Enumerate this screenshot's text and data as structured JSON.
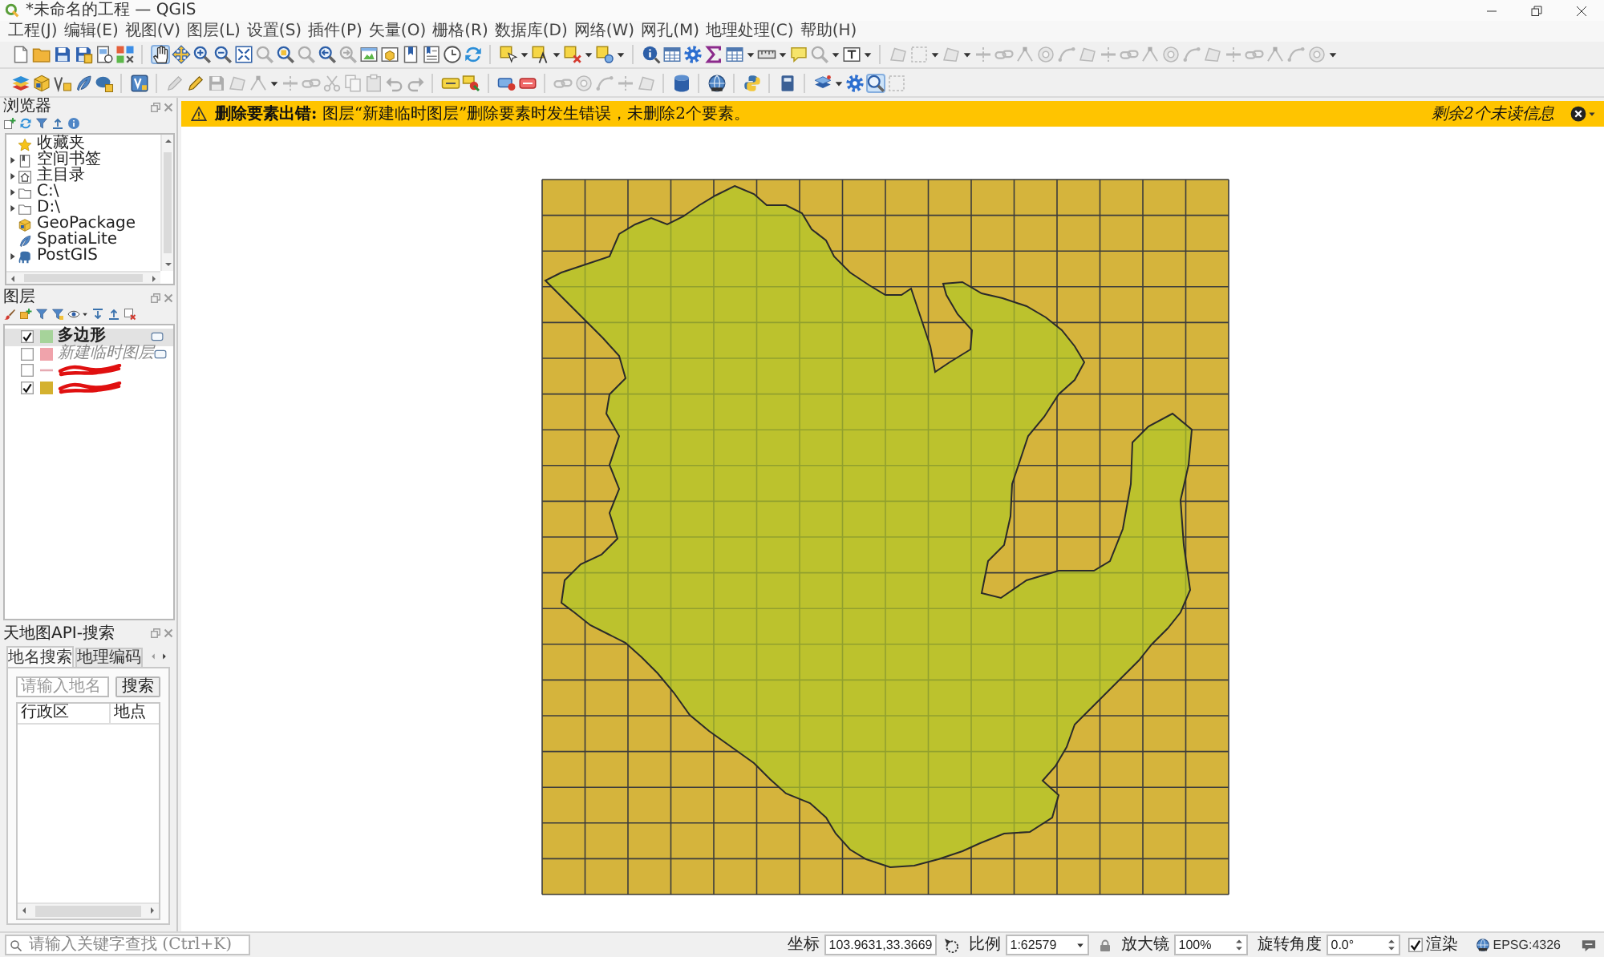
{
  "window": {
    "title": "*未命名的工程 — QGIS"
  },
  "menu_bar": [
    "工程(J)",
    "编辑(E)",
    "视图(V)",
    "图层(L)",
    "设置(S)",
    "插件(P)",
    "矢量(O)",
    "栅格(R)",
    "数据库(D)",
    "网络(W)",
    "网孔(M)",
    "地理处理(C)",
    "帮助(H)"
  ],
  "toolbars": [
    [
      {
        "kind": "new",
        "disabled": false,
        "selected": false
      },
      {
        "kind": "open",
        "disabled": false,
        "selected": false
      },
      {
        "kind": "save",
        "disabled": false,
        "selected": false
      },
      {
        "kind": "saveas",
        "disabled": false,
        "selected": false
      },
      {
        "kind": "layout",
        "disabled": false,
        "selected": false
      },
      {
        "kind": "style",
        "disabled": false,
        "selected": false
      },
      {
        "kind": "sep"
      },
      {
        "kind": "pan",
        "disabled": false,
        "selected": true
      },
      {
        "kind": "move",
        "disabled": false,
        "selected": false
      },
      {
        "kind": "zin",
        "disabled": false,
        "selected": false
      },
      {
        "kind": "zout",
        "disabled": false,
        "selected": false
      },
      {
        "kind": "zfull",
        "disabled": false,
        "selected": false
      },
      {
        "kind": "mag",
        "disabled": true,
        "selected": false
      },
      {
        "kind": "zlayer",
        "disabled": false,
        "selected": false
      },
      {
        "kind": "mag",
        "disabled": true,
        "selected": false
      },
      {
        "kind": "zlast",
        "disabled": false,
        "selected": false
      },
      {
        "kind": "znext",
        "disabled": true,
        "selected": false
      },
      {
        "kind": "view",
        "disabled": false,
        "selected": false
      },
      {
        "kind": "view3d",
        "disabled": false,
        "selected": false
      },
      {
        "kind": "bmark",
        "disabled": false,
        "selected": false
      },
      {
        "kind": "bmlist",
        "disabled": false,
        "selected": false
      },
      {
        "kind": "clock",
        "disabled": false,
        "selected": false
      },
      {
        "kind": "refresh",
        "disabled": false,
        "selected": false
      },
      {
        "kind": "sep"
      },
      {
        "kind": "select",
        "disabled": false,
        "selected": false
      },
      {
        "kind": "caret"
      },
      {
        "kind": "selexpr",
        "disabled": false,
        "selected": false
      },
      {
        "kind": "caret"
      },
      {
        "kind": "desel",
        "disabled": false,
        "selected": false
      },
      {
        "kind": "caret"
      },
      {
        "kind": "selloc",
        "disabled": false,
        "selected": false
      },
      {
        "kind": "caret"
      },
      {
        "kind": "sep"
      },
      {
        "kind": "info",
        "disabled": false,
        "selected": false
      },
      {
        "kind": "attr",
        "disabled": false,
        "selected": false
      },
      {
        "kind": "gear",
        "disabled": false,
        "selected": false
      },
      {
        "kind": "sigma",
        "disabled": false,
        "selected": false
      },
      {
        "kind": "attr",
        "disabled": false,
        "selected": false
      },
      {
        "kind": "caret"
      },
      {
        "kind": "ruler",
        "disabled": false,
        "selected": false
      },
      {
        "kind": "caret"
      },
      {
        "kind": "tip",
        "disabled": false,
        "selected": false
      },
      {
        "kind": "mag",
        "disabled": true,
        "selected": false
      },
      {
        "kind": "caret"
      },
      {
        "kind": "text",
        "disabled": false,
        "selected": false
      },
      {
        "kind": "caret"
      },
      {
        "kind": "sep"
      },
      {
        "kind": "poly",
        "disabled": true,
        "selected": false
      },
      {
        "kind": "frame",
        "disabled": true,
        "selected": false
      },
      {
        "kind": "caret"
      },
      {
        "kind": "poly",
        "disabled": true,
        "selected": false
      },
      {
        "kind": "caret"
      },
      {
        "kind": "split",
        "disabled": true,
        "selected": false
      },
      {
        "kind": "link",
        "disabled": true,
        "selected": false
      },
      {
        "kind": "vertex",
        "disabled": true,
        "selected": false
      },
      {
        "kind": "ring",
        "disabled": true,
        "selected": false
      },
      {
        "kind": "curve",
        "disabled": true,
        "selected": false
      },
      {
        "kind": "poly",
        "disabled": true,
        "selected": false
      },
      {
        "kind": "split",
        "disabled": true,
        "selected": false
      },
      {
        "kind": "link",
        "disabled": true,
        "selected": false
      },
      {
        "kind": "vertex",
        "disabled": true,
        "selected": false
      },
      {
        "kind": "ring",
        "disabled": true,
        "selected": false
      },
      {
        "kind": "curve",
        "disabled": true,
        "selected": false
      },
      {
        "kind": "poly",
        "disabled": true,
        "selected": false
      },
      {
        "kind": "split",
        "disabled": true,
        "selected": false
      },
      {
        "kind": "link",
        "disabled": true,
        "selected": false
      },
      {
        "kind": "vertex",
        "disabled": true,
        "selected": false
      },
      {
        "kind": "curve",
        "disabled": true,
        "selected": false
      },
      {
        "kind": "ring",
        "disabled": true,
        "selected": false
      },
      {
        "kind": "caret"
      }
    ],
    [
      {
        "kind": "addlayer",
        "disabled": false,
        "selected": false
      },
      {
        "kind": "package",
        "disabled": false,
        "selected": false
      },
      {
        "kind": "vadd",
        "disabled": false,
        "selected": false
      },
      {
        "kind": "feather",
        "disabled": false,
        "selected": false
      },
      {
        "kind": "dbadd",
        "disabled": false,
        "selected": false
      },
      {
        "kind": "sep"
      },
      {
        "kind": "virtual",
        "disabled": false,
        "selected": false
      },
      {
        "kind": "sep"
      },
      {
        "kind": "pencil",
        "disabled": true,
        "selected": false
      },
      {
        "kind": "pencil",
        "disabled": false,
        "selected": false
      },
      {
        "kind": "save",
        "disabled": true,
        "selected": false
      },
      {
        "kind": "poly",
        "disabled": true,
        "selected": false
      },
      {
        "kind": "vertex",
        "disabled": true,
        "selected": false
      },
      {
        "kind": "caret"
      },
      {
        "kind": "split",
        "disabled": true,
        "selected": false
      },
      {
        "kind": "link",
        "disabled": true,
        "selected": false
      },
      {
        "kind": "scissors",
        "disabled": true,
        "selected": false
      },
      {
        "kind": "copy",
        "disabled": true,
        "selected": false
      },
      {
        "kind": "paste",
        "disabled": true,
        "selected": false
      },
      {
        "kind": "undo",
        "disabled": true,
        "selected": false
      },
      {
        "kind": "redo",
        "disabled": true,
        "selected": false
      },
      {
        "kind": "sep"
      },
      {
        "kind": "label",
        "disabled": false,
        "selected": false
      },
      {
        "kind": "pin",
        "disabled": false,
        "selected": false
      },
      {
        "kind": "sep"
      },
      {
        "kind": "tag",
        "disabled": false,
        "selected": false
      },
      {
        "kind": "tagred",
        "disabled": false,
        "selected": false
      },
      {
        "kind": "sep"
      },
      {
        "kind": "link",
        "disabled": true,
        "selected": false
      },
      {
        "kind": "ring",
        "disabled": true,
        "selected": false
      },
      {
        "kind": "curve",
        "disabled": true,
        "selected": false
      },
      {
        "kind": "split",
        "disabled": true,
        "selected": false
      },
      {
        "kind": "poly",
        "disabled": true,
        "selected": false
      },
      {
        "kind": "sep"
      },
      {
        "kind": "db",
        "disabled": false,
        "selected": false
      },
      {
        "kind": "sep"
      },
      {
        "kind": "globe",
        "disabled": false,
        "selected": false
      },
      {
        "kind": "sep"
      },
      {
        "kind": "python",
        "disabled": false,
        "selected": false
      },
      {
        "kind": "sep"
      },
      {
        "kind": "book",
        "disabled": false,
        "selected": false
      },
      {
        "kind": "sep"
      },
      {
        "kind": "layers",
        "disabled": false,
        "selected": false
      },
      {
        "kind": "caret"
      },
      {
        "kind": "gear",
        "disabled": false,
        "selected": false
      },
      {
        "kind": "mag",
        "disabled": false,
        "selected": true
      },
      {
        "kind": "frame",
        "disabled": true,
        "selected": false
      }
    ]
  ],
  "message_bar": {
    "kind": "warning",
    "text": "**删除要素出错:** 图层“新建临时图层”删除要素时发生错误，未删除2个要素。",
    "remaining": "剩余2个未读信息"
  },
  "browser_panel": {
    "title": "浏览器",
    "items": [
      {
        "label": "收藏夹",
        "kind": "favorites",
        "expandable": false,
        "expanded": false
      },
      {
        "label": "空间书签",
        "kind": "bookmarks",
        "expandable": true,
        "expanded": false
      },
      {
        "label": "主目录",
        "kind": "home",
        "expandable": true,
        "expanded": false
      },
      {
        "label": "C:\\",
        "kind": "drive",
        "expandable": true,
        "expanded": false
      },
      {
        "label": "D:\\",
        "kind": "drive",
        "expandable": true,
        "expanded": false
      },
      {
        "label": "GeoPackage",
        "kind": "geopackage",
        "expandable": false,
        "expanded": false
      },
      {
        "label": "SpatiaLite",
        "kind": "spatialite",
        "expandable": false,
        "expanded": false
      },
      {
        "label": "PostGIS",
        "kind": "postgis",
        "expandable": true,
        "expanded": false
      }
    ]
  },
  "layers_panel": {
    "title": "图层",
    "layers": [
      {
        "name": "多边形",
        "kind": "fill",
        "color": "#a6d39a",
        "visible": true,
        "selected": true,
        "indicator": true,
        "redacted": false
      },
      {
        "name": "新建临时图层",
        "kind": "fill",
        "color": "#f0a3ab",
        "visible": false,
        "selected": false,
        "indicator": true,
        "redacted": false
      },
      {
        "kind": "line",
        "color": "#e6aab2",
        "visible": false,
        "selected": false,
        "indicator": false,
        "redacted": true
      },
      {
        "kind": "fill",
        "color": "#d4b12f",
        "visible": true,
        "selected": false,
        "indicator": false,
        "redacted": true
      }
    ]
  },
  "tianditu_panel": {
    "title": "天地图API-搜索",
    "tabs": [
      {
        "label": "地名搜索",
        "selected": true
      },
      {
        "label": "地理编码",
        "selected": false
      }
    ],
    "search": {
      "placeholder": "请输入地名",
      "button": "搜索"
    },
    "table": {
      "columns": [
        "行政区",
        "地点"
      ]
    }
  },
  "status_bar": {
    "locator": {
      "placeholder": "请输入关键字查找 (Ctrl+K)"
    },
    "coordinate_label": "坐标",
    "coordinate": "103.9631,33.3669",
    "scale_label": "比例",
    "scale": "1:62579",
    "magnifier_label": "放大镜",
    "magnifier": "100%",
    "rotation_label": "旋转角度",
    "rotation": "0.0°",
    "render": {
      "label": "渲染",
      "checked": true
    },
    "crs": "EPSG:4326"
  }
}
